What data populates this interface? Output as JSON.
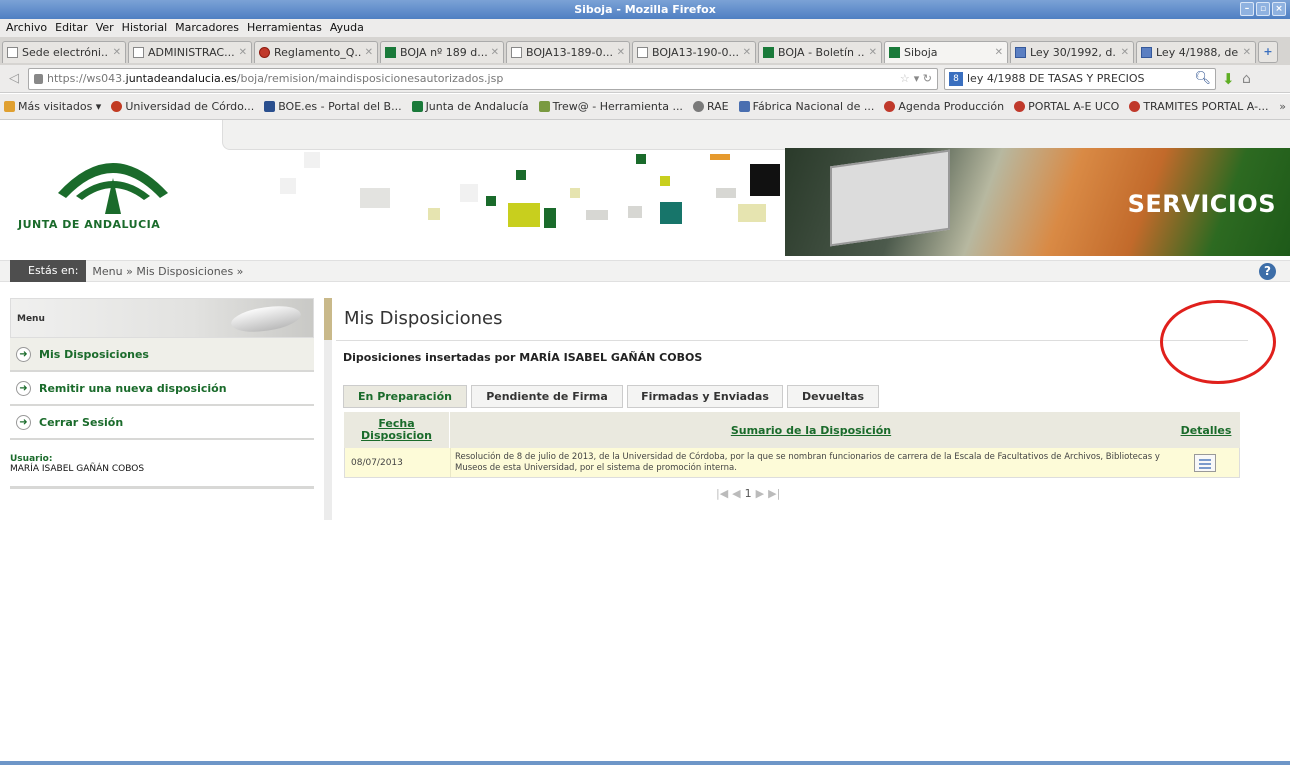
{
  "window": {
    "title": "Siboja - Mozilla Firefox"
  },
  "menubar": [
    "Archivo",
    "Editar",
    "Ver",
    "Historial",
    "Marcadores",
    "Herramientas",
    "Ayuda"
  ],
  "tabs": [
    {
      "title": "Sede electróni...",
      "icon": "blank-page-icon"
    },
    {
      "title": "ADMINISTRAC...",
      "icon": "blank-page-icon"
    },
    {
      "title": "Reglamento_Q...",
      "icon": "red-circle-icon"
    },
    {
      "title": "BOJA nº 189 d...",
      "icon": "junta-andalucia-icon"
    },
    {
      "title": "BOJA13-189-0...",
      "icon": "blank-page-icon"
    },
    {
      "title": "BOJA13-190-0...",
      "icon": "blank-page-icon"
    },
    {
      "title": "BOJA - Boletín ...",
      "icon": "junta-andalucia-icon"
    },
    {
      "title": "Siboja",
      "icon": "junta-andalucia-icon",
      "active": true
    },
    {
      "title": "Ley 30/1992, d...",
      "icon": "document-icon"
    },
    {
      "title": "Ley 4/1988, de ...",
      "icon": "document-icon"
    }
  ],
  "nav": {
    "url_prefix": "https://ws043.",
    "url_domain": "juntadeandalucia.es",
    "url_path": "/boja/remision/maindisposicionesautorizados.jsp",
    "search_value": "ley 4/1988 DE TASAS Y PRECIOS"
  },
  "bookmarks": [
    {
      "label": "Más visitados ▾",
      "color": "#e0a030"
    },
    {
      "label": "Universidad de Córdo...",
      "color": "#c23b22"
    },
    {
      "label": "BOE.es - Portal del B...",
      "color": "#2a4f8e"
    },
    {
      "label": "Junta de Andalucía",
      "color": "#1a7a3a"
    },
    {
      "label": "Trew@ - Herramienta ...",
      "color": "#7a9a40"
    },
    {
      "label": "RAE",
      "color": "#7a7a7a"
    },
    {
      "label": "Fábrica Nacional de ...",
      "color": "#4a6fb0"
    },
    {
      "label": "Agenda Producción",
      "color": "#c0392b"
    },
    {
      "label": "PORTAL A-E UCO",
      "color": "#c0392b"
    },
    {
      "label": "TRAMITES PORTAL A-...",
      "color": "#c0392b"
    }
  ],
  "bookmarks_more": "»",
  "header": {
    "logo_text": "JUNTA DE ANDALUCIA",
    "banner_text": "SERVICIOS"
  },
  "breadcrumb": {
    "label": "Estás en:",
    "path": "Menu »  Mis Disposiciones »"
  },
  "leftmenu": {
    "title": "Menu",
    "items": [
      {
        "label": "Mis Disposiciones",
        "active": true
      },
      {
        "label": "Remitir una nueva disposición"
      },
      {
        "label": "Cerrar Sesión"
      }
    ],
    "user_label": "Usuario:",
    "user_name": "MARÍA ISABEL GAÑÁN COBOS"
  },
  "main": {
    "title": "Mis Disposiciones",
    "subtitle": "Diposiciones insertadas por MARÍA ISABEL GAÑÁN COBOS",
    "tabs": [
      "En Preparación",
      "Pendiente de Firma",
      "Firmadas y Enviadas",
      "Devueltas"
    ],
    "table": {
      "headers": {
        "date": "Fecha Disposicion",
        "summary": "Sumario de la Disposición",
        "details": "Detalles"
      },
      "rows": [
        {
          "date": "08/07/2013",
          "summary": "Resolución de 8 de julio de 2013, de la Universidad de Córdoba, por la que se nombran funcionarios de carrera de la Escala de Facultativos de Archivos, Bibliotecas y Museos de esta Universidad, por el sistema de promoción interna."
        }
      ]
    },
    "pager": {
      "page": "1"
    }
  },
  "colors": {
    "accent_green": "#1a6b2b",
    "highlight_circle": "#e0201c",
    "row_bg": "#fdfbd8"
  }
}
